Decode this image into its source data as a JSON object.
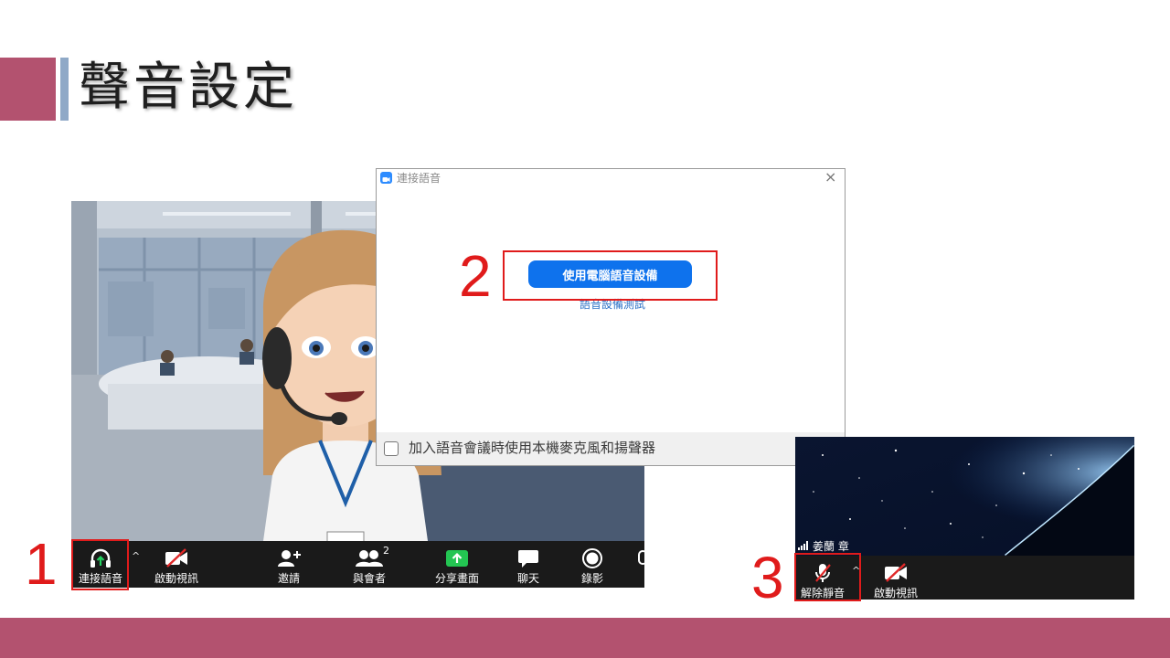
{
  "slide": {
    "title": "聲音設定",
    "step_labels": [
      "1",
      "2",
      "3"
    ],
    "accent_color": "#b3526f",
    "secondary_accent_color": "#8fa9c7",
    "highlight_color": "#e01b1b"
  },
  "meeting_toolbar": {
    "items": [
      {
        "label": "連接語音",
        "icon": "headphones-icon"
      },
      {
        "label": "啟動視訊",
        "icon": "video-off-icon"
      },
      {
        "label": "邀請",
        "icon": "add-person-icon"
      },
      {
        "label": "與會者",
        "icon": "participants-icon",
        "badge": "2"
      },
      {
        "label": "分享畫面",
        "icon": "share-screen-icon"
      },
      {
        "label": "聊天",
        "icon": "chat-icon"
      },
      {
        "label": "錄影",
        "icon": "record-icon"
      }
    ],
    "caret": "^"
  },
  "audio_dialog": {
    "title": "連接語音",
    "primary_button": "使用電腦語音設備",
    "test_link": "語音設備測試",
    "checkbox_label": "加入語音會議時使用本機麥克風和揚聲器",
    "checkbox_checked": false,
    "close": "×",
    "primary_color": "#0e72ed"
  },
  "small_toolbar": {
    "participant_name": "姜蘭 章",
    "items": [
      {
        "label": "解除靜音",
        "icon": "mic-muted-icon"
      },
      {
        "label": "啟動視訊",
        "icon": "video-off-icon"
      }
    ],
    "caret": "^"
  }
}
